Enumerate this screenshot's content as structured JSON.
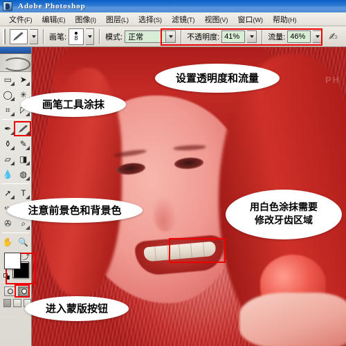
{
  "window": {
    "title": "Adobe Photoshop",
    "logo_icon": "photoshop-logo-icon"
  },
  "menubar": {
    "items": [
      {
        "label": "文件",
        "mnemonic": "(F)"
      },
      {
        "label": "编辑",
        "mnemonic": "(E)"
      },
      {
        "label": "图像",
        "mnemonic": "(I)"
      },
      {
        "label": "图层",
        "mnemonic": "(L)"
      },
      {
        "label": "选择",
        "mnemonic": "(S)"
      },
      {
        "label": "滤镜",
        "mnemonic": "(T)"
      },
      {
        "label": "视图",
        "mnemonic": "(V)"
      },
      {
        "label": "窗口",
        "mnemonic": "(W)"
      },
      {
        "label": "帮助",
        "mnemonic": "(H)"
      }
    ]
  },
  "options_bar": {
    "tool_preset_icon": "brush-tool-icon",
    "brush_label": "画笔:",
    "brush_size": "8",
    "mode_label": "模式:",
    "mode_value": "正常",
    "opacity_label": "不透明度:",
    "opacity_value": "41%",
    "flow_label": "流量:",
    "flow_value": "46%",
    "airbrush_icon": "airbrush-icon",
    "highlight_color": "#ee0000"
  },
  "toolbox": {
    "tools": [
      {
        "name": "marquee-tool",
        "glyph": "▭"
      },
      {
        "name": "move-tool",
        "glyph": "➤"
      },
      {
        "name": "lasso-tool",
        "glyph": "◯"
      },
      {
        "name": "magic-wand-tool",
        "glyph": "✳"
      },
      {
        "name": "crop-tool",
        "glyph": "⌗"
      },
      {
        "name": "slice-tool",
        "glyph": "⊿"
      },
      {
        "name": "healing-brush-tool",
        "glyph": "✒"
      },
      {
        "name": "brush-tool",
        "glyph": "🖌"
      },
      {
        "name": "clone-stamp-tool",
        "glyph": "⚱"
      },
      {
        "name": "history-brush-tool",
        "glyph": "✎"
      },
      {
        "name": "eraser-tool",
        "glyph": "▱"
      },
      {
        "name": "gradient-tool",
        "glyph": "◨"
      },
      {
        "name": "blur-tool",
        "glyph": "💧"
      },
      {
        "name": "dodge-tool",
        "glyph": "🔍"
      },
      {
        "name": "path-selection-tool",
        "glyph": "➚"
      },
      {
        "name": "type-tool",
        "glyph": "T"
      },
      {
        "name": "pen-tool",
        "glyph": "✑"
      },
      {
        "name": "shape-tool",
        "glyph": "▭"
      },
      {
        "name": "notes-tool",
        "glyph": "✇"
      },
      {
        "name": "eyedropper-tool",
        "glyph": "⌕"
      },
      {
        "name": "hand-tool",
        "glyph": "✋"
      },
      {
        "name": "zoom-tool",
        "glyph": "🔎"
      }
    ],
    "foreground_color": "#ffffff",
    "background_color": "#000000",
    "swap_icon": "swap-colors-icon",
    "reset_icon": "reset-colors-icon",
    "quick_mask_off_icon": "standard-mode-icon",
    "quick_mask_on_icon": "quick-mask-mode-icon",
    "screen_modes": [
      "standard-screen-mode",
      "full-screen-menubar-mode",
      "full-screen-mode"
    ]
  },
  "canvas": {
    "watermark": "PH",
    "teeth_selection_box_color": "#ee0000"
  },
  "callouts": [
    {
      "id": "callout-opacity-flow",
      "lines": [
        "设置透明度和流量"
      ]
    },
    {
      "id": "callout-brush-tool",
      "lines": [
        "画笔工具涂抹"
      ]
    },
    {
      "id": "callout-fg-bg-color",
      "lines": [
        "注意前景色和背景色"
      ]
    },
    {
      "id": "callout-white-paint-teeth",
      "lines": [
        "用白色涂抹需要",
        "修改牙齿区域"
      ]
    },
    {
      "id": "callout-enter-mask",
      "lines": [
        "进入蒙版按钮"
      ]
    }
  ]
}
